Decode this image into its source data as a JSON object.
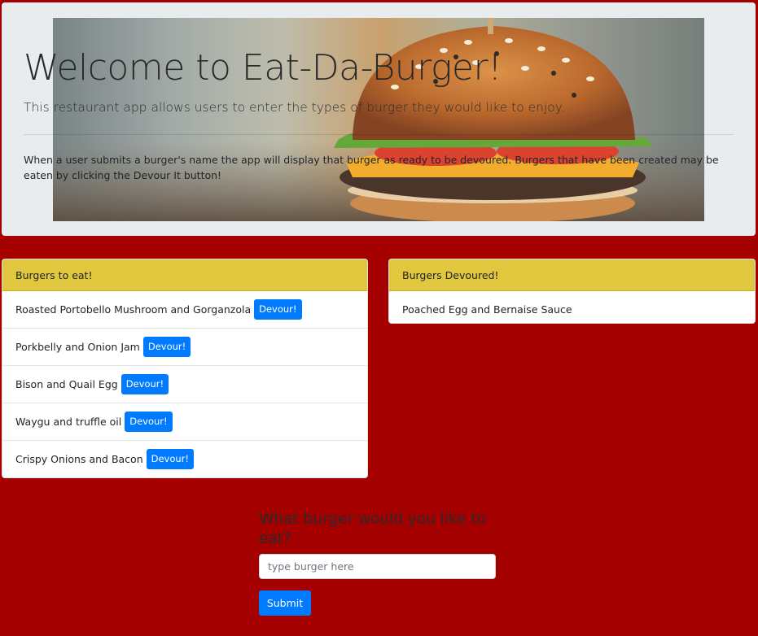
{
  "jumbotron": {
    "title": "Welcome to Eat-Da-Burger!",
    "lead": "This restaurant app allows users to enter the types of burger they would like to enjoy.",
    "description": "When a user submits a burger's name the app will display that burger as ready to be devoured. Burgers that have been created may be eaten by clicking the Devour It button!"
  },
  "to_eat": {
    "header": "Burgers to eat!",
    "devour_label": "Devour!",
    "items": [
      {
        "name": "Roasted Portobello Mushroom and Gorganzola"
      },
      {
        "name": "Porkbelly and Onion Jam"
      },
      {
        "name": "Bison and Quail Egg"
      },
      {
        "name": "Waygu and truffle oil"
      },
      {
        "name": "Crispy Onions and Bacon"
      }
    ]
  },
  "devoured": {
    "header": "Burgers Devoured!",
    "items": [
      {
        "name": "Poached Egg and Bernaise Sauce"
      }
    ]
  },
  "form": {
    "title": "What burger would you like to eat?",
    "placeholder": "type burger here",
    "value": "",
    "submit_label": "Submit"
  },
  "colors": {
    "page_background": "#a50000",
    "card_header": "#e0c73d",
    "button": "#007bff"
  },
  "icons": {
    "hero": "burger-photo"
  }
}
